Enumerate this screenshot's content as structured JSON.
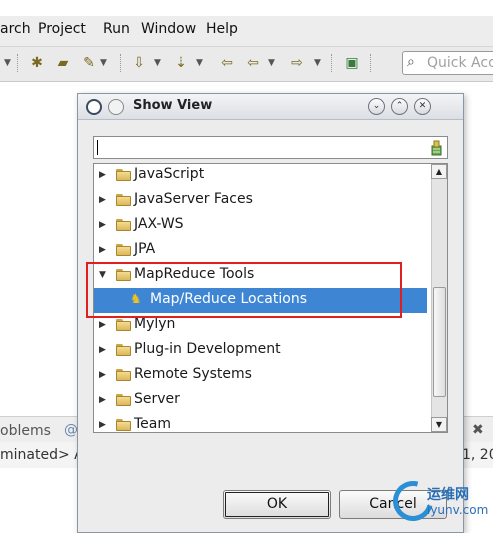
{
  "menubar": {
    "items": [
      "arch",
      "Project",
      "Run",
      "Window",
      "Help"
    ]
  },
  "toolbar": {
    "quick_access_placeholder": "Quick Acc"
  },
  "background": {
    "problems_tab": "oblems",
    "console_text": "minated> A",
    "console_right": "1, 20"
  },
  "dialog": {
    "title": "Show View",
    "filter_value": "",
    "tree": [
      {
        "label": "JavaScript",
        "expanded": false
      },
      {
        "label": "JavaServer Faces",
        "expanded": false
      },
      {
        "label": "JAX-WS",
        "expanded": false
      },
      {
        "label": "JPA",
        "expanded": false
      },
      {
        "label": "MapReduce Tools",
        "expanded": true
      },
      {
        "label": "Map/Reduce Locations",
        "child": true,
        "selected": true
      },
      {
        "label": "Mylyn",
        "expanded": false
      },
      {
        "label": "Plug-in Development",
        "expanded": false
      },
      {
        "label": "Remote Systems",
        "expanded": false
      },
      {
        "label": "Server",
        "expanded": false
      },
      {
        "label": "Team",
        "expanded": false
      }
    ],
    "ok_label": "OK",
    "cancel_label": "Cancel"
  },
  "watermark": {
    "cn": "运维网",
    "url": "iyunv.com"
  },
  "colors": {
    "selection": "#3e86d4",
    "highlight_box": "#e0201e"
  }
}
